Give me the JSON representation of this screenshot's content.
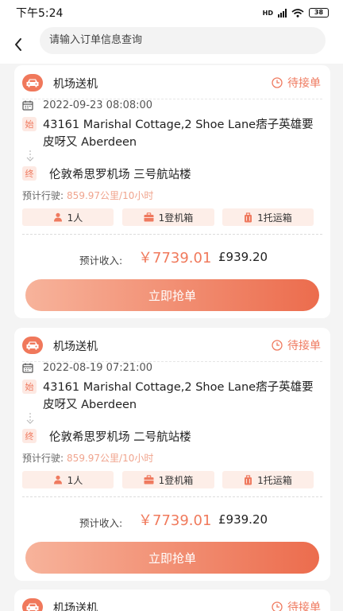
{
  "status_bar": {
    "time": "下午5:24",
    "battery": "38",
    "network": "HD"
  },
  "search": {
    "placeholder": "请输入订单信息查询"
  },
  "orders": [
    {
      "service_type": "机场送机",
      "status": "待接单",
      "datetime": "2022-09-23 08:08:00",
      "start_tag": "始",
      "start_address": "43161 Marishal Cottage,2 Shoe Lane痞子英雄要皮呀又 Aberdeen",
      "end_tag": "终",
      "end_address": "伦敦希思罗机场 三号航站楼",
      "estimate_label": "预计行驶:",
      "estimate_value": "859.97公里/10小时",
      "passengers": "1人",
      "boarding_luggage": "1登机箱",
      "checked_luggage": "1托运箱",
      "income_label": "预计收入:",
      "income_cny": "￥7739.01",
      "income_gbp": "£939.20",
      "button_label": "立即抢单"
    },
    {
      "service_type": "机场送机",
      "status": "待接单",
      "datetime": "2022-08-19 07:21:00",
      "start_tag": "始",
      "start_address": "43161 Marishal Cottage,2 Shoe Lane痞子英雄要皮呀又 Aberdeen",
      "end_tag": "终",
      "end_address": "伦敦希思罗机场 二号航站楼",
      "estimate_label": "预计行驶:",
      "estimate_value": "859.97公里/10小时",
      "passengers": "1人",
      "boarding_luggage": "1登机箱",
      "checked_luggage": "1托运箱",
      "income_label": "预计收入:",
      "income_cny": "￥7739.01",
      "income_gbp": "£939.20",
      "button_label": "立即抢单"
    },
    {
      "service_type": "机场送机",
      "status": "待接单"
    }
  ],
  "colors": {
    "accent": "#ef7a5f",
    "tag_bg": "#fde9e3",
    "chip_bg": "#fdeee8",
    "estimate_value": "#f0a48e",
    "page_bg": "#f4f4f4"
  },
  "icons": {
    "back": "chevron-left-icon",
    "car": "car-icon",
    "status": "clock-icon",
    "calendar": "calendar-icon",
    "route": "down-arrow-icon",
    "passenger": "person-icon",
    "boarding": "suitcase-icon",
    "checked": "luggage-icon"
  }
}
